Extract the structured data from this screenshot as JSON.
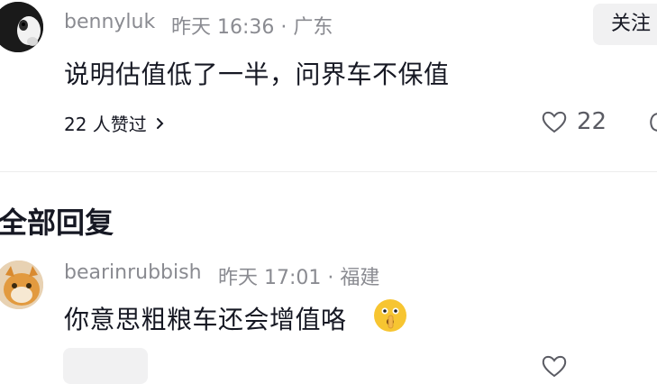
{
  "comment1": {
    "username": "bennyluk",
    "time": "昨天 16:36 · 广东",
    "text": "说明估值低了一半，问界车不保值",
    "follow_label": "关注",
    "likers": "22 人赞过",
    "like_count": "22"
  },
  "section": {
    "title": "全部回复"
  },
  "reply1": {
    "username": "bearinrubbish",
    "time": "昨天 17:01 · 福建",
    "text": "你意思粗粮车还会增值咯"
  },
  "colors": {
    "text": "#161823",
    "muted": "#8a8b91",
    "button_bg": "#f1f1f2",
    "emoji": "#f7c531"
  },
  "icons": [
    "avatar",
    "heart-icon",
    "chevron-right-icon",
    "emoji-shush-icon"
  ]
}
